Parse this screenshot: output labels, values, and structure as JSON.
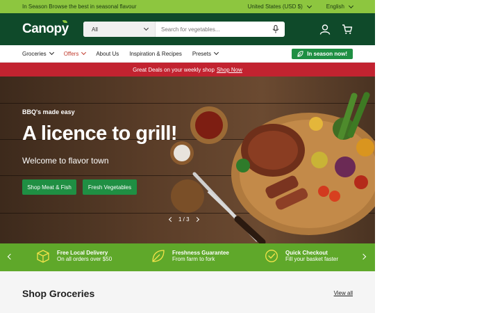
{
  "announcement": {
    "text": "In Season Browse the best in seasonal flavour",
    "country": "United States (USD $)",
    "language": "English"
  },
  "header": {
    "logo": "Canopy",
    "category": "All",
    "search_placeholder": "Search for vegetables..."
  },
  "nav": {
    "items": [
      {
        "label": "Groceries"
      },
      {
        "label": "Offers"
      },
      {
        "label": "About Us"
      },
      {
        "label": "Inspiration & Recipes"
      },
      {
        "label": "Presets"
      }
    ],
    "season_button": "In season now!"
  },
  "promo": {
    "text": "Great Deals on your weekly shop",
    "link": "Shop Now"
  },
  "hero": {
    "kicker": "BBQ's made easy",
    "title": "A licence to grill!",
    "subtitle": "Welcome to flavor town",
    "button1": "Shop Meat & Fish",
    "button2": "Fresh Vegetables",
    "slide_indicator": "1 / 3"
  },
  "features": [
    {
      "title": "Free Local Delivery",
      "sub": "On all orders over $50",
      "icon": "box-icon"
    },
    {
      "title": "Freshness Guarantee",
      "sub": "From farm to fork",
      "icon": "leaf-icon"
    },
    {
      "title": "Quick Checkout",
      "sub": "Fill your basket faster",
      "icon": "check-circle-icon"
    }
  ],
  "groceries": {
    "title": "Shop Groceries",
    "view_all": "View all"
  },
  "colors": {
    "announce": "#8dc63f",
    "header": "#0f4a2a",
    "accent": "#1f8f43",
    "promo": "#c22330"
  }
}
